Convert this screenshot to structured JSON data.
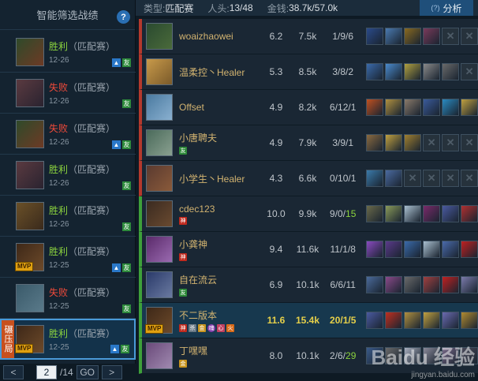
{
  "sidebar": {
    "header": "智能筛选战绩",
    "help": "?",
    "matches": [
      {
        "result": "胜利",
        "mode": "（匹配赛）",
        "date": "12-26",
        "win": true,
        "mvp": false,
        "crush": false,
        "badges": [
          "blue",
          "green"
        ],
        "colors": [
          "#2f4a2a",
          "#6d3a25"
        ]
      },
      {
        "result": "失败",
        "mode": "（匹配赛）",
        "date": "12-26",
        "win": false,
        "mvp": false,
        "crush": false,
        "badges": [
          "green"
        ],
        "colors": [
          "#5a3a40",
          "#2a2330"
        ]
      },
      {
        "result": "失败",
        "mode": "（匹配赛）",
        "date": "12-26",
        "win": false,
        "mvp": false,
        "crush": false,
        "badges": [
          "blue",
          "green"
        ],
        "colors": [
          "#2f4a2a",
          "#6d3a25"
        ]
      },
      {
        "result": "胜利",
        "mode": "（匹配赛）",
        "date": "12-26",
        "win": true,
        "mvp": false,
        "crush": false,
        "badges": [
          "green"
        ],
        "colors": [
          "#5a3a40",
          "#2a2330"
        ]
      },
      {
        "result": "胜利",
        "mode": "（匹配赛）",
        "date": "12-26",
        "win": true,
        "mvp": false,
        "crush": false,
        "badges": [
          "green"
        ],
        "colors": [
          "#6a5028",
          "#3a2a1c"
        ]
      },
      {
        "result": "胜利",
        "mode": "（匹配赛）",
        "date": "12-25",
        "win": true,
        "mvp": true,
        "crush": false,
        "badges": [
          "blue",
          "green"
        ],
        "colors": [
          "#3e2818",
          "#6d4a2a"
        ]
      },
      {
        "result": "失败",
        "mode": "（匹配赛）",
        "date": "12-25",
        "win": false,
        "mvp": false,
        "crush": false,
        "badges": [
          "green"
        ],
        "colors": [
          "#3a5a6a",
          "#5a7a8a"
        ]
      },
      {
        "result": "胜利",
        "mode": "（匹配赛）",
        "date": "12-25",
        "win": true,
        "mvp": true,
        "crush": true,
        "crush_label": "碾压局",
        "badges": [
          "blue",
          "green"
        ],
        "colors": [
          "#3e2818",
          "#6d4a2a"
        ]
      }
    ],
    "pagination": {
      "prev": "<",
      "page": "2",
      "total": "/14",
      "go": "GO",
      "next": ">"
    }
  },
  "topbar": {
    "type_label": "类型:",
    "type_value": "匹配赛",
    "heads_label": "人头:",
    "heads_value": "13/48",
    "gold_label": "金钱:",
    "gold_value": "38.7k/57.0k",
    "analysis_small": "(?)",
    "analysis_label": "分析"
  },
  "players": [
    {
      "name": "woaizhaowei",
      "score": "6.2",
      "gold": "7.5k",
      "kda": "1/9/6",
      "team": "red",
      "me": false,
      "mvp": false,
      "tags": [],
      "avatar": [
        "#2a4a30",
        "#4a6a3a"
      ],
      "items": [
        "#2a4a8a",
        "#4a7ab0",
        "#8a6a20",
        "#7a3a5a",
        null,
        null
      ]
    },
    {
      "name": "温柔控丶Healer",
      "score": "5.3",
      "gold": "8.5k",
      "kda": "3/8/2",
      "team": "red",
      "me": false,
      "mvp": false,
      "tags": [],
      "avatar": [
        "#c89a4a",
        "#7a5a2a"
      ],
      "items": [
        "#3a6aaa",
        "#4a8acc",
        "#b0a040",
        "#8a8a8a",
        "#6a6a6a",
        null
      ]
    },
    {
      "name": "Offset",
      "score": "4.9",
      "gold": "8.2k",
      "kda": "6/12/1",
      "team": "red",
      "me": false,
      "mvp": false,
      "tags": [],
      "avatar": [
        "#4a7aa0",
        "#8ab0d0"
      ],
      "items": [
        "#c05020",
        "#b09040",
        "#8a7a6a",
        "#3a5a9a",
        "#2a8ac0",
        "#c0a040"
      ]
    },
    {
      "name": "小唐聘夫",
      "score": "4.9",
      "gold": "7.9k",
      "kda": "3/9/1",
      "team": "red",
      "me": false,
      "mvp": false,
      "tags": [
        "green"
      ],
      "avatar": [
        "#4a6a5a",
        "#8aa090"
      ],
      "items": [
        "#8a6a40",
        "#c0a040",
        "#a08030",
        null,
        null,
        null
      ]
    },
    {
      "name": "小学生丶Healer",
      "score": "4.3",
      "gold": "6.6k",
      "kda": "0/10/1",
      "team": "red",
      "me": false,
      "mvp": false,
      "tags": [],
      "avatar": [
        "#5a3a30",
        "#8a5a3a"
      ],
      "items": [
        "#3a7aaa",
        "#4a6aa0",
        null,
        null,
        null,
        null
      ]
    },
    {
      "name": "cdec123",
      "score": "10.0",
      "gold": "9.9k",
      "kda": "9/0/15",
      "kda_green_part": "15",
      "team": "green",
      "me": false,
      "mvp": false,
      "tags": [
        "red"
      ],
      "avatar": [
        "#3a2a20",
        "#6a4a30"
      ],
      "items": [
        "#6a6a4a",
        "#8a9a5a",
        "#aac0d0",
        "#7a2a6a",
        "#4a5aa0",
        "#b03030"
      ]
    },
    {
      "name": "小龚神",
      "score": "9.4",
      "gold": "11.6k",
      "kda": "11/1/8",
      "team": "green",
      "me": false,
      "mvp": false,
      "tags": [
        "red"
      ],
      "avatar": [
        "#5a2a6a",
        "#9a6ab0"
      ],
      "items": [
        "#8a4ac0",
        "#5a3a8a",
        "#3a6aaa",
        "#aac0d0",
        "#4a6aaa",
        "#c02020"
      ]
    },
    {
      "name": "自在流云",
      "score": "6.9",
      "gold": "10.1k",
      "kda": "6/6/11",
      "team": "green",
      "me": false,
      "mvp": false,
      "tags": [
        "green"
      ],
      "avatar": [
        "#2a3a6a",
        "#6a7aa0"
      ],
      "items": [
        "#4a6a9a",
        "#8a4a8a",
        "#6a6a6a",
        "#a04040",
        "#c02020",
        "#7a7aaa"
      ]
    },
    {
      "name": "不二版本",
      "score": "11.6",
      "gold": "15.4k",
      "kda": "20/1/5",
      "team": "green",
      "me": true,
      "mvp": true,
      "tags": [
        "red",
        "gray",
        "gold",
        "purple",
        "pink",
        "orange"
      ],
      "avatar": [
        "#3e2818",
        "#6d4a2a"
      ],
      "items": [
        "#4a5aa0",
        "#c03020",
        "#b09040",
        "#c0a040",
        "#6a6ab0",
        "#b08a30"
      ]
    },
    {
      "name": "丁嘿嘿",
      "score": "8.0",
      "gold": "10.1k",
      "kda": "2/6/29",
      "kda_green_part": "29",
      "team": "green",
      "me": false,
      "mvp": false,
      "tags": [
        "gold"
      ],
      "avatar": [
        "#6a4a7a",
        "#a08ab0"
      ],
      "items": [
        "#3a5a8a",
        "#6a6a6a",
        "#aab0c0",
        "#8a8a9a",
        "#7a6a8a",
        "#4a4a5a"
      ]
    }
  ],
  "tag_glyphs": {
    "red": "神",
    "green": "友",
    "gray": "杀",
    "gold": "金",
    "purple": "魂",
    "pink": "心",
    "orange": "火"
  },
  "watermark": {
    "big": "Baidu 经验",
    "small": "jingyan.baidu.com"
  }
}
